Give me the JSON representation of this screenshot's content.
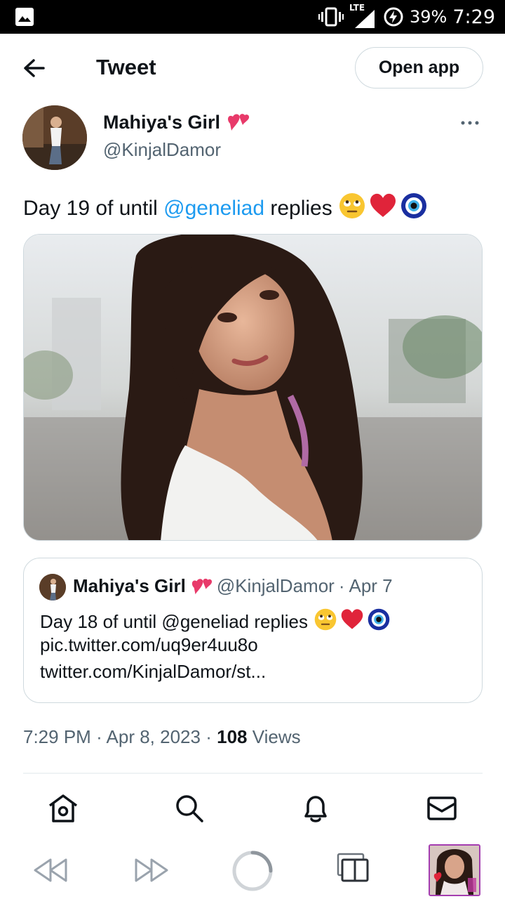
{
  "status_bar": {
    "network": "LTE",
    "battery": "39%",
    "time": "7:29"
  },
  "header": {
    "title": "Tweet",
    "open_app": "Open app"
  },
  "tweet": {
    "author_name": "Mahiya's Girl",
    "author_handle": "@KinjalDamor",
    "text_prefix": "Day 19 of until ",
    "mention": "@geneliad",
    "text_suffix": " replies",
    "emojis": [
      "rolling-eyes",
      "red-heart",
      "nazar-amulet"
    ],
    "media_alt": "photo"
  },
  "quoted": {
    "author_name": "Mahiya's Girl",
    "author_handle": "@KinjalDamor",
    "separator": "·",
    "date": "Apr 7",
    "line1": "Day 18 of until @geneliad replies",
    "line2": "pic.twitter.com/uq9er4uu8o",
    "line3": "twitter.com/KinjalDamor/st..."
  },
  "meta": {
    "time": "7:29 PM",
    "separator": "·",
    "date": "Apr 8, 2023",
    "views_count": "108",
    "views_label": " Views"
  },
  "bottom_nav": [
    "home-icon",
    "search-icon",
    "notifications-icon",
    "messages-icon"
  ],
  "browser_bar": [
    "back-icon",
    "forward-icon",
    "reload-icon",
    "tabs-icon",
    "profile-thumbnail"
  ],
  "colors": {
    "accent": "#1d9bf0",
    "text": "#0f1419",
    "secondary": "#536471",
    "border": "#cfd9de"
  }
}
